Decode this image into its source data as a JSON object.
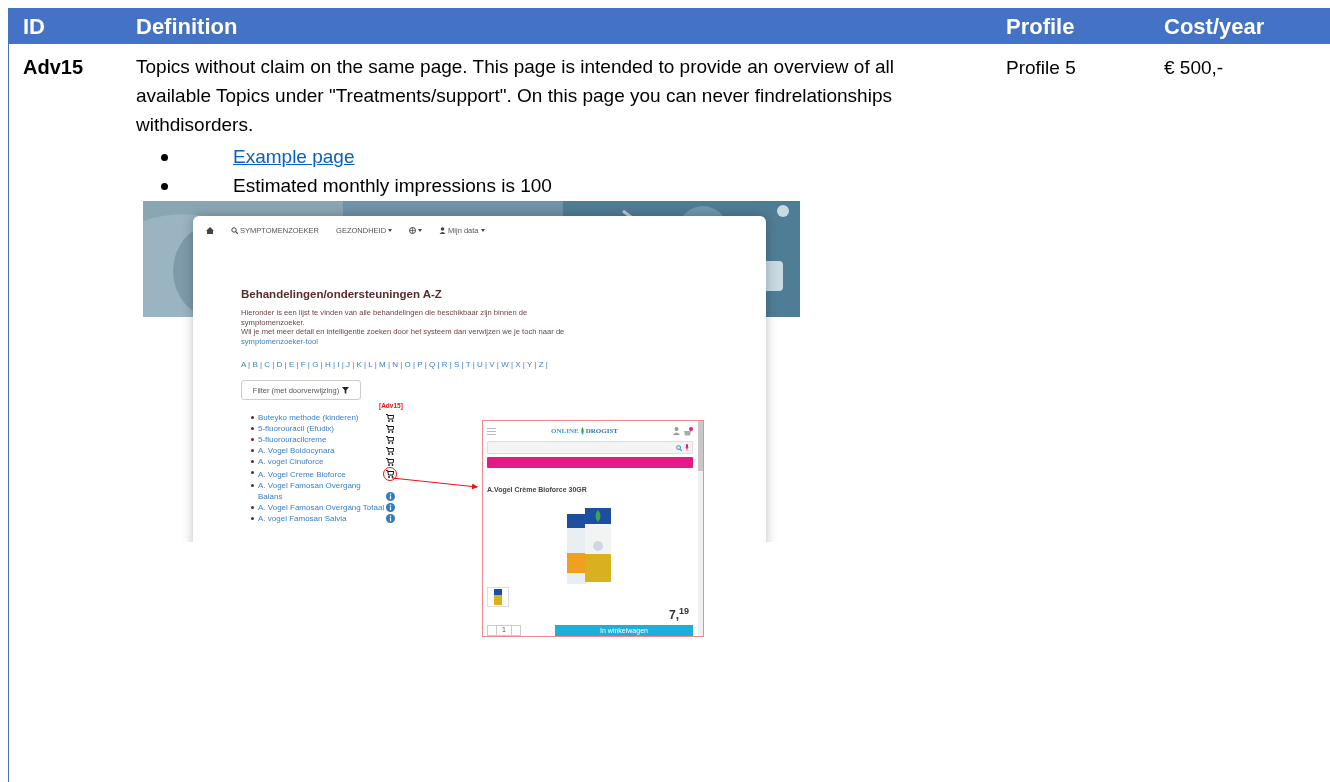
{
  "table": {
    "columns": [
      "ID",
      "Definition",
      "Profile",
      "Cost/year"
    ],
    "rows": [
      {
        "id": "Adv15",
        "definition": "Topics without claim on the same page. This page is intended to provide an overview of all available Topics under \"Treatments/support\". On this page you can never  findrelationships withdisorders.",
        "profile": "Profile 5",
        "cost": "€ 500,-",
        "bullets": [
          {
            "kind": "link",
            "text": "Example page"
          },
          {
            "kind": "text",
            "text": "Estimated monthly impressions is 100"
          }
        ],
        "screenshot": {
          "nav": [
            {
              "kind": "home"
            },
            {
              "kind": "search",
              "label": "SYMPTOMENZOEKER"
            },
            {
              "kind": "dropdown",
              "label": "GEZONDHEID"
            },
            {
              "kind": "globe"
            },
            {
              "kind": "user",
              "label": "Mijn data"
            }
          ],
          "heading": "Behandelingen/ondersteuningen A-Z",
          "intro": "Hieronder is een lijst te vinden van alle behandelingen die beschikbaar zijn binnen de symptomenzoeker.",
          "intro_2": "Wil je met meer detail en intelligentie zoeken door het systeem dan verwijzen we je toch naar de",
          "intro_link": "symptomenzoeker-tool",
          "alphabet": "A | B | C | D | E | F | G | H | I | J | K | L | M | N | O | P | Q | R | S | T | U | V | W | X | Y | Z |",
          "filter": "Filter (met doorverwijzing)",
          "marker": "[Adv15]",
          "items": [
            {
              "text": "Buteyko methode (kinderen)",
              "kind": "cart",
              "highlighted": false
            },
            {
              "text": "5-fluorouracil (Efudix)",
              "kind": "cart",
              "highlighted": false
            },
            {
              "text": "5-fluorouracilcreme",
              "kind": "cart",
              "highlighted": false
            },
            {
              "text": "A. Vogel Boldocynara",
              "kind": "cart",
              "highlighted": false
            },
            {
              "text": "A. vogel Cinuforce",
              "kind": "cart",
              "highlighted": false
            },
            {
              "text": "A. Vogel Creme Bioforce",
              "kind": "cart",
              "highlighted": true
            },
            {
              "text": "A. Vogel Famosan Overgang Balans",
              "kind": "info",
              "highlighted": false
            },
            {
              "text": "A. Vogel Famosan Overgang Totaal",
              "kind": "info",
              "highlighted": false
            },
            {
              "text": "A. vogel Famosan Salvia",
              "kind": "info",
              "highlighted": false
            }
          ],
          "popup": {
            "logo": [
              "ONLINE",
              "DROGIST"
            ],
            "title": "A.Vogel Crème Bioforce 30GR",
            "price": "7,$^{19}$",
            "quantity": "1",
            "button": "In winkelwagen"
          }
        }
      }
    ]
  }
}
